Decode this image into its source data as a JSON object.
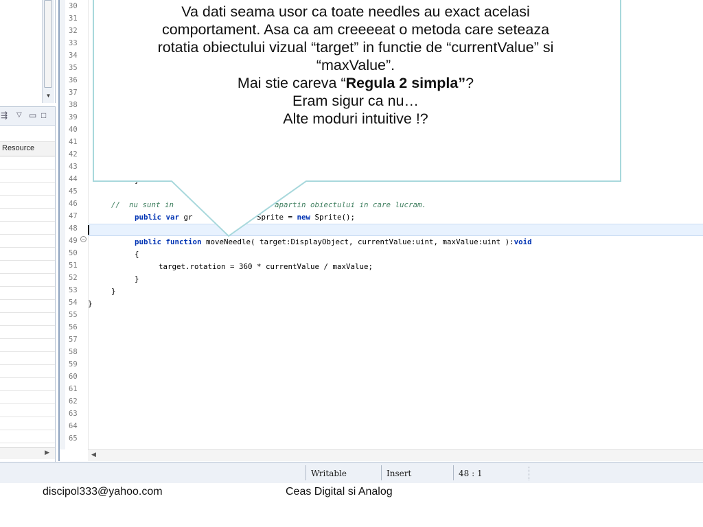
{
  "left_panel": {
    "column_header": "Resource"
  },
  "editor": {
    "line_numbers": [
      "30",
      "31",
      "32",
      "33",
      "34",
      "35",
      "36",
      "37",
      "38",
      "39",
      "40",
      "41",
      "42",
      "43",
      "44",
      "45",
      "46",
      "47",
      "48",
      "49",
      "50",
      "51",
      "52",
      "53",
      "54",
      "55",
      "56",
      "57",
      "58",
      "59",
      "60",
      "61",
      "62",
      "63",
      "64",
      "65"
    ],
    "partial_line_44": "}",
    "line_46_comment_start": "//  nu sunt in",
    "line_46_comment_end": "i sus, eu apartin obiectului in care lucram.",
    "line_47_public": "public",
    "line_47_var": "var",
    "line_47_gr": " gr",
    "line_47_sprite": "Sprite = ",
    "line_47_new": "new",
    "line_47_tail": " Sprite();",
    "line_49_public": "public",
    "line_49_function": "function",
    "line_49_signature": " moveNeedle( target:DisplayObject, currentValue:uint, maxValue:uint ):",
    "line_49_void": "void",
    "line_50": "{",
    "line_51": "target.rotation = 360 * currentValue / maxValue;",
    "line_52": "}",
    "line_53": "}",
    "line_54": "}"
  },
  "status_bar": {
    "writable": "Writable",
    "insert": "Insert",
    "position": "48 : 1"
  },
  "callout": {
    "line1": "Va dati seama usor ca toate needles au exact acelasi",
    "line2": "comportament. Asa ca am creeeeat o metoda care seteaza",
    "line3": "rotatia obiectului vizual “target” in functie de “currentValue” si",
    "line4": "“maxValue”.",
    "line5_prefix": "Mai stie careva “",
    "line5_bold": "Regula 2 simpla”",
    "line5_suffix": "?",
    "line6": "Eram sigur ca nu…",
    "line7": "Alte moduri intuitive !?"
  },
  "footer": {
    "email": "discipol333@yahoo.com",
    "title": "Ceas Digital si Analog"
  },
  "colors": {
    "callout_border": "#a8d8dc",
    "keyword": "#0033b3",
    "comment": "#3f7f5f",
    "current_line": "#e8f2fe"
  }
}
